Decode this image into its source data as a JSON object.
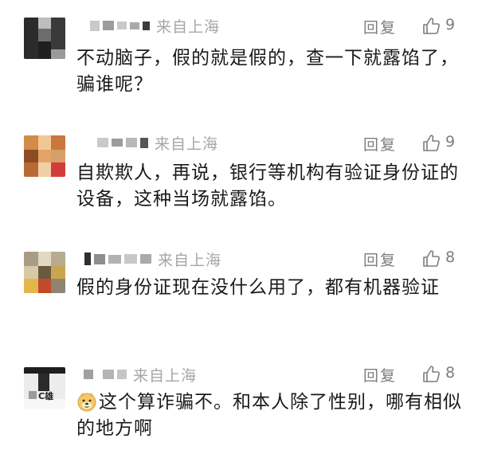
{
  "comments": [
    {
      "location": "来自上海",
      "reply_label": "回复",
      "likes": "9",
      "text": "不动脑子，假的就是假的，查一下就露馅了，骗谁呢？"
    },
    {
      "location": "来自上海",
      "reply_label": "回复",
      "likes": "9",
      "text": "自欺欺人，再说，银行等机构有验证身份证的设备，这种当场就露馅。"
    },
    {
      "location": "来自上海",
      "reply_label": "回复",
      "likes": "8",
      "text": "假的身份证现在没什么用了，都有机器验证"
    },
    {
      "location": "来自上海",
      "reply_label": "回复",
      "likes": "8",
      "avatar_text": "C雄",
      "text": "这个算诈骗不。和本人除了性别，哪有相似的地方啊"
    }
  ],
  "icons": {
    "like": "thumbs-up-outline-icon",
    "emoji": "doge-emoji-icon"
  },
  "colors": {
    "meta": "#a6a6a6",
    "action": "#7d7d7d",
    "text": "#1a1a1a"
  }
}
